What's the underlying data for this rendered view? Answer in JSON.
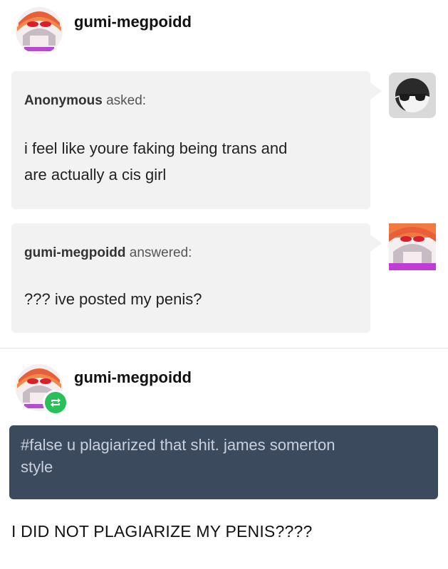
{
  "post": {
    "author": "gumi-megpoidd"
  },
  "ask": {
    "asker_name": "Anonymous",
    "asker_verb": "asked:",
    "question_line1": "i feel like youre faking being trans and",
    "question_line2": "are actually a cis girl"
  },
  "answer": {
    "answerer_name": "gumi-megpoidd",
    "answerer_verb": "answered:",
    "text": "??? ive posted my penis?"
  },
  "reblog": {
    "author": "gumi-megpoidd",
    "tags_line1": "#false u plagiarized that shit. james somerton",
    "tags_line2": "style"
  },
  "caption": "I DID NOT PLAGIARIZE MY PENIS????",
  "icons": {
    "anon_avatar": "sunglasses-face-icon",
    "reblog_badge": "reblog-arrows-icon"
  },
  "colors": {
    "bubble": "#f2f2f2",
    "tag_box": "#3c4a5e",
    "reblog_green": "#29c05a"
  }
}
